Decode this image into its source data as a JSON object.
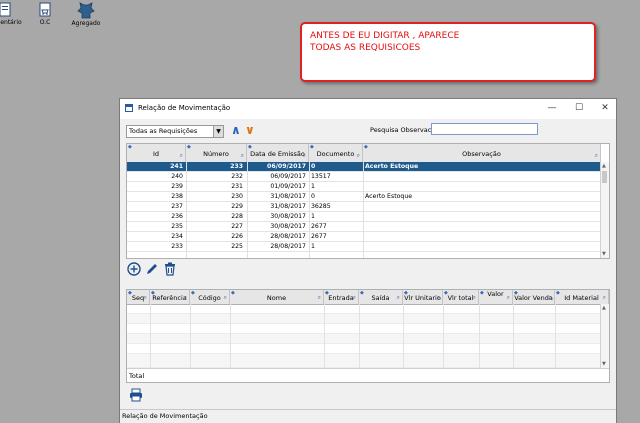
{
  "toolbar": {
    "items": [
      {
        "label": "entário",
        "icon": "inventory-icon"
      },
      {
        "label": "O.C",
        "icon": "purchase-order-icon"
      },
      {
        "label": "Agregado",
        "icon": "leather-icon"
      }
    ]
  },
  "note": {
    "line1": "ANTES DE EU DIGITAR , APARECE",
    "line2": "TODAS AS REQUISICOES",
    "color": "#e01010"
  },
  "window": {
    "title": "Relação de Movimentação",
    "controls": {
      "minimize": "—",
      "maximize": "☐",
      "close": "✕"
    },
    "filter_value": "Todas as Requisições",
    "search_label": "Pesquisa Observacao",
    "search_value": "",
    "grid1": {
      "columns": [
        "Id",
        "Número",
        "Data de Emissão",
        "Documento",
        "Observação"
      ],
      "rows": [
        [
          "241",
          "233",
          "06/09/2017",
          "0",
          "Acerto Estoque"
        ],
        [
          "240",
          "232",
          "06/09/2017",
          "13517",
          ""
        ],
        [
          "239",
          "231",
          "01/09/2017",
          "1",
          ""
        ],
        [
          "238",
          "230",
          "31/08/2017",
          "0",
          "Acerto Estoque"
        ],
        [
          "237",
          "229",
          "31/08/2017",
          "36285",
          ""
        ],
        [
          "236",
          "228",
          "30/08/2017",
          "1",
          ""
        ],
        [
          "235",
          "227",
          "30/08/2017",
          "2677",
          ""
        ],
        [
          "234",
          "226",
          "28/08/2017",
          "2677",
          ""
        ],
        [
          "233",
          "225",
          "28/08/2017",
          "1",
          ""
        ]
      ],
      "selected_row": 0
    },
    "grid2": {
      "columns": [
        "Seq",
        "Referência",
        "Código",
        "Nome",
        "Entrada",
        "Saída",
        "Vlr Unitario",
        "Vlr total",
        "Valor",
        "Valor Venda",
        "Id Material"
      ],
      "total_label": "Total"
    },
    "status_text": "Relação de Movimentação",
    "selection_color": "#1f5a8c"
  }
}
